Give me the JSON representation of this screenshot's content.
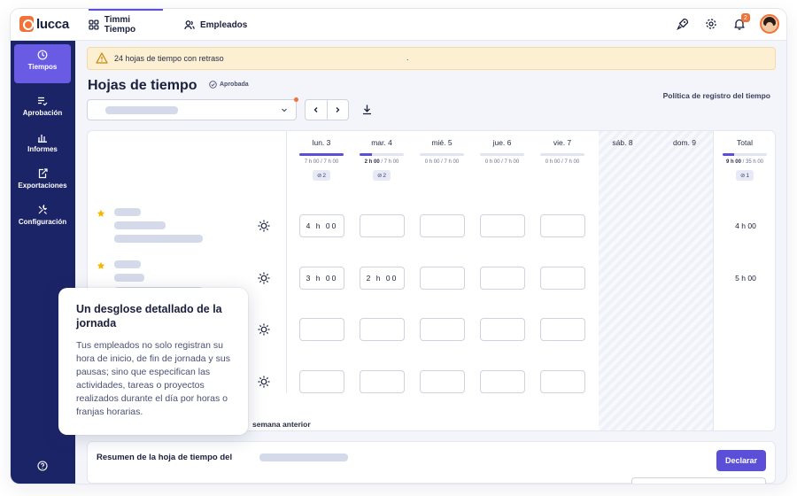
{
  "app": {
    "name": "lucca"
  },
  "topnav": {
    "tabs": [
      {
        "label": "Timmi Tiempo"
      },
      {
        "label": "Empleados"
      }
    ],
    "notification_count": "2"
  },
  "sidebar": {
    "items": [
      {
        "label": "Tiempos"
      },
      {
        "label": "Aprobación"
      },
      {
        "label": "Informes"
      },
      {
        "label": "Exportaciones"
      },
      {
        "label": "Configuración"
      }
    ]
  },
  "alert": {
    "text": "24 hojas de tiempo con retraso",
    "suffix": "."
  },
  "page": {
    "title": "Hojas de tiempo",
    "status": "Aprobada",
    "policy_link": "Política de registro del tiempo"
  },
  "week": {
    "days": [
      {
        "label": "lun. 3",
        "worked": "7 h 00",
        "planned": "7 h 00",
        "progress": 1.0,
        "comments": "2"
      },
      {
        "label": "mar. 4",
        "worked": "2 h 00",
        "planned": "7 h 00",
        "progress": 0.28,
        "comments": "2"
      },
      {
        "label": "mié. 5",
        "worked": "0 h 00",
        "planned": "7 h 00",
        "progress": 0
      },
      {
        "label": "jue. 6",
        "worked": "0 h 00",
        "planned": "7 h 00",
        "progress": 0
      },
      {
        "label": "vie. 7",
        "worked": "0 h 00",
        "planned": "7 h 00",
        "progress": 0
      }
    ],
    "weekend": [
      {
        "label": "sáb. 8"
      },
      {
        "label": "dom. 9"
      }
    ],
    "total": {
      "label": "Total",
      "worked": "9 h 00",
      "planned": "35 h 00",
      "progress": 0.26,
      "comments": "1"
    },
    "separator": "/"
  },
  "rows": [
    {
      "values": [
        "4 h 00",
        "",
        "",
        "",
        ""
      ],
      "total": "4 h 00",
      "starred": true
    },
    {
      "values": [
        "3 h 00",
        "2 h 00",
        "",
        "",
        ""
      ],
      "total": "5 h 00",
      "starred": true
    },
    {
      "values": [
        "",
        "",
        "",
        "",
        ""
      ],
      "total": "",
      "starred": false
    },
    {
      "values": [
        "",
        "",
        "",
        "",
        ""
      ],
      "total": "",
      "starred": false
    }
  ],
  "copy_previous": "semana anterior",
  "summary": {
    "title": "Resumen de la hoja de tiempo del",
    "declare_label": "Declarar"
  },
  "tooltip": {
    "title": "Un desglose detallado de la jornada",
    "body": "Tus empleados no solo registran su hora de inicio, de fin de jornada y sus pausas; sino que especifican las actividades, tareas o proyectos realizados durante el día por horas o franjas horarias."
  },
  "colors": {
    "sidebar": "#1c2468",
    "accent": "#5b4fd8",
    "brand": "#f0743a",
    "alert_bg": "#fcefd2"
  }
}
